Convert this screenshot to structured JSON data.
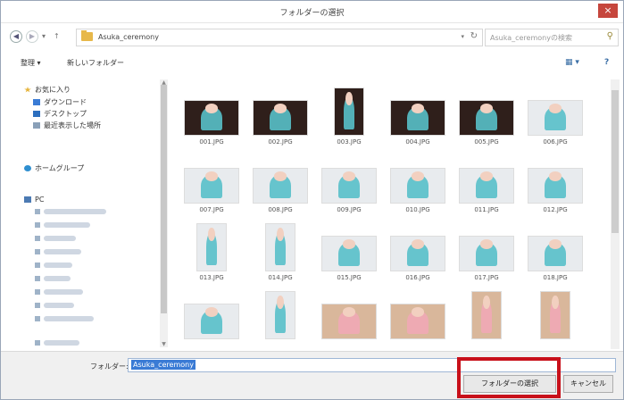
{
  "window": {
    "title": "フォルダーの選択",
    "close": "×"
  },
  "nav": {
    "back": "◀",
    "forward": "▶",
    "dropdown": "▾",
    "up": "↑",
    "path": "Asuka_ceremony",
    "path_dropdown": "▾",
    "refresh": "↻",
    "search_placeholder": "Asuka_ceremonyの検索",
    "search_icon": "magnifier-icon"
  },
  "toolbar": {
    "organize": "整理 ▾",
    "new_folder": "新しいフォルダー",
    "view_icon": "▦ ▾",
    "help_icon": "?"
  },
  "sidebar": {
    "favorites_header": "お気に入り",
    "favorites": [
      "ダウンロード",
      "デスクトップ",
      "最近表示した場所"
    ],
    "homegroup": "ホームグループ",
    "pc": "PC"
  },
  "files": [
    {
      "name": "001.JPG",
      "tone": "dark",
      "orientation": "landscape"
    },
    {
      "name": "002.JPG",
      "tone": "dark",
      "orientation": "landscape"
    },
    {
      "name": "003.JPG",
      "tone": "dark",
      "orientation": "portrait"
    },
    {
      "name": "004.JPG",
      "tone": "dark",
      "orientation": "landscape"
    },
    {
      "name": "005.JPG",
      "tone": "dark",
      "orientation": "landscape"
    },
    {
      "name": "006.JPG",
      "tone": "light",
      "orientation": "landscape"
    },
    {
      "name": "007.JPG",
      "tone": "light",
      "orientation": "landscape"
    },
    {
      "name": "008.JPG",
      "tone": "light",
      "orientation": "landscape"
    },
    {
      "name": "009.JPG",
      "tone": "light",
      "orientation": "landscape"
    },
    {
      "name": "010.JPG",
      "tone": "light",
      "orientation": "landscape"
    },
    {
      "name": "011.JPG",
      "tone": "light",
      "orientation": "landscape"
    },
    {
      "name": "012.JPG",
      "tone": "light",
      "orientation": "landscape"
    },
    {
      "name": "013.JPG",
      "tone": "light",
      "orientation": "portrait"
    },
    {
      "name": "014.JPG",
      "tone": "light",
      "orientation": "portrait"
    },
    {
      "name": "015.JPG",
      "tone": "light",
      "orientation": "landscape"
    },
    {
      "name": "016.JPG",
      "tone": "light",
      "orientation": "landscape"
    },
    {
      "name": "017.JPG",
      "tone": "light",
      "orientation": "landscape"
    },
    {
      "name": "018.JPG",
      "tone": "light",
      "orientation": "landscape"
    },
    {
      "name": "",
      "tone": "light",
      "orientation": "landscape"
    },
    {
      "name": "",
      "tone": "light",
      "orientation": "portrait"
    },
    {
      "name": "",
      "tone": "warm",
      "orientation": "landscape"
    },
    {
      "name": "",
      "tone": "warm",
      "orientation": "landscape"
    },
    {
      "name": "",
      "tone": "warm",
      "orientation": "portrait"
    },
    {
      "name": "",
      "tone": "warm",
      "orientation": "portrait"
    }
  ],
  "bottom": {
    "folder_label": "フォルダー:",
    "folder_value": "Asuka_ceremony",
    "select_button": "フォルダーの選択",
    "cancel_button": "キャンセル"
  },
  "colors": {
    "highlight": "#c8101a",
    "close": "#c6463d",
    "selection": "#3a7bd5"
  }
}
